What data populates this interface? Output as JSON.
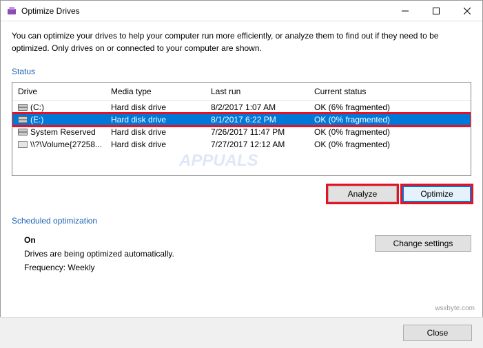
{
  "window": {
    "title": "Optimize Drives"
  },
  "description": "You can optimize your drives to help your computer run more efficiently, or analyze them to find out if they need to be optimized. Only drives on or connected to your computer are shown.",
  "status_label": "Status",
  "table": {
    "headers": {
      "drive": "Drive",
      "media": "Media type",
      "lastrun": "Last run",
      "status": "Current status"
    },
    "rows": [
      {
        "drive": "(C:)",
        "media": "Hard disk drive",
        "lastrun": "8/2/2017 1:07 AM",
        "status": "OK (6% fragmented)",
        "selected": false
      },
      {
        "drive": "(E:)",
        "media": "Hard disk drive",
        "lastrun": "8/1/2017 6:22 PM",
        "status": "OK (0% fragmented)",
        "selected": true
      },
      {
        "drive": "System Reserved",
        "media": "Hard disk drive",
        "lastrun": "7/26/2017 11:47 PM",
        "status": "OK (0% fragmented)",
        "selected": false
      },
      {
        "drive": "\\\\?\\Volume{27258...",
        "media": "Hard disk drive",
        "lastrun": "7/27/2017 12:12 AM",
        "status": "OK (0% fragmented)",
        "selected": false
      }
    ]
  },
  "buttons": {
    "analyze": "Analyze",
    "optimize": "Optimize",
    "change_settings": "Change settings",
    "close": "Close"
  },
  "scheduled": {
    "label": "Scheduled optimization",
    "on": "On",
    "desc": "Drives are being optimized automatically.",
    "frequency": "Frequency: Weekly"
  },
  "watermark": "wsxbyte.com"
}
